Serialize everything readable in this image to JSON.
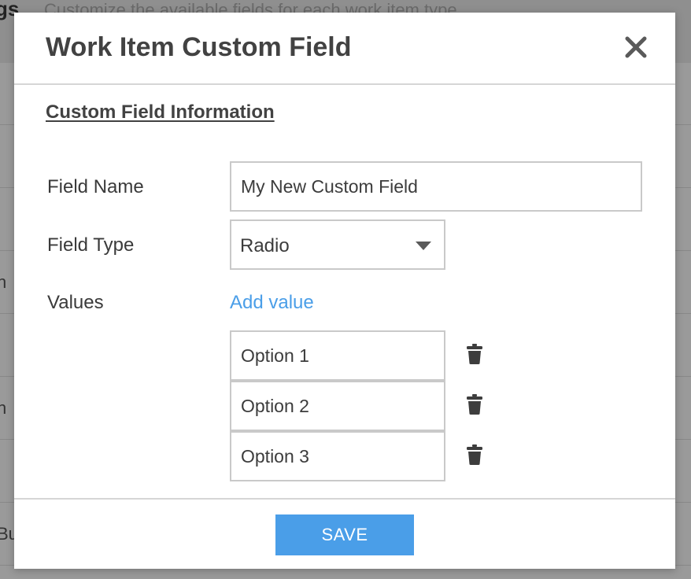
{
  "background": {
    "header_title": "gs",
    "header_description": "Customize the available fields for each work item type",
    "row_fragments": [
      "n",
      "n",
      "Bu"
    ]
  },
  "modal": {
    "title": "Work Item Custom Field",
    "close_icon": "close-icon",
    "section_title": "Custom Field Information",
    "field_name": {
      "label": "Field Name",
      "value": "My New Custom Field"
    },
    "field_type": {
      "label": "Field Type",
      "value": "Radio",
      "caret_icon": "caret-down-icon"
    },
    "values": {
      "label": "Values",
      "add_link": "Add value",
      "options": [
        "Option 1",
        "Option 2",
        "Option 3"
      ],
      "delete_icon": "trash-icon"
    },
    "save_label": "SAVE"
  },
  "colors": {
    "accent": "#4a9ee8",
    "title_text": "#424242",
    "input_border": "#c9c9c9",
    "overlay": "#9a9a9a"
  }
}
